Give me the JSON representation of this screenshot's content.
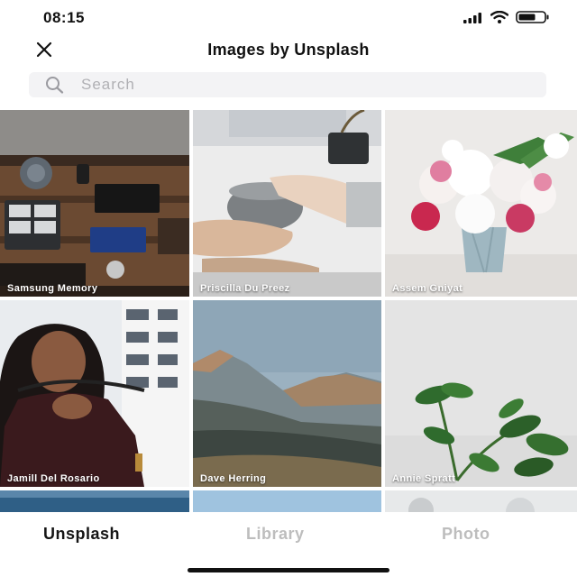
{
  "status": {
    "time": "08:15",
    "icons": [
      "signal-icon",
      "wifi-icon",
      "battery-icon"
    ]
  },
  "header": {
    "title": "Images by Unsplash",
    "close_icon": "close-icon"
  },
  "search": {
    "placeholder": "Search",
    "value": ""
  },
  "photos": [
    {
      "credit": "Samsung Memory"
    },
    {
      "credit": "Priscilla Du Preez"
    },
    {
      "credit": "Assem Gniyat"
    },
    {
      "credit": "Jamill Del Rosario"
    },
    {
      "credit": "Dave Herring"
    },
    {
      "credit": "Annie Spratt"
    }
  ],
  "tabs": [
    {
      "label": "Unsplash",
      "active": true
    },
    {
      "label": "Library",
      "active": false
    },
    {
      "label": "Photo",
      "active": false
    }
  ],
  "colors": {
    "active_tab": "#151515",
    "inactive_tab": "#bdbdbd",
    "search_bg": "#f3f3f5"
  }
}
